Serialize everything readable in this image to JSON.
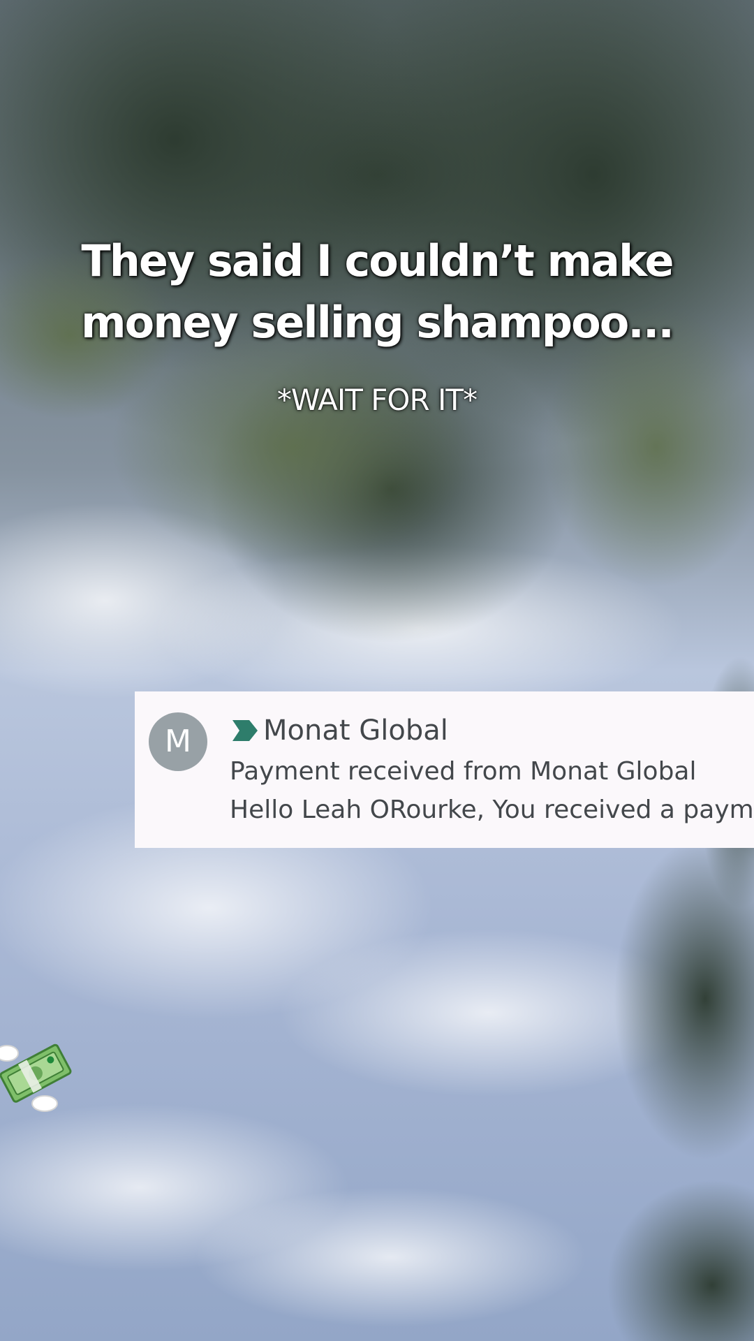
{
  "overlay": {
    "title_line1": "They said I couldn’t make",
    "title_line2": "money selling shampoo...",
    "subtitle": "*WAIT FOR IT*"
  },
  "notification": {
    "avatar_letter": "M",
    "sender": "Monat Global",
    "subject": "Payment received from Monat Global",
    "preview": "Hello Leah ORourke, You received a payme",
    "label_icon": "important-label-icon",
    "label_color": "#2e7d6b"
  },
  "sticker": {
    "icon": "money-with-wings-icon"
  }
}
